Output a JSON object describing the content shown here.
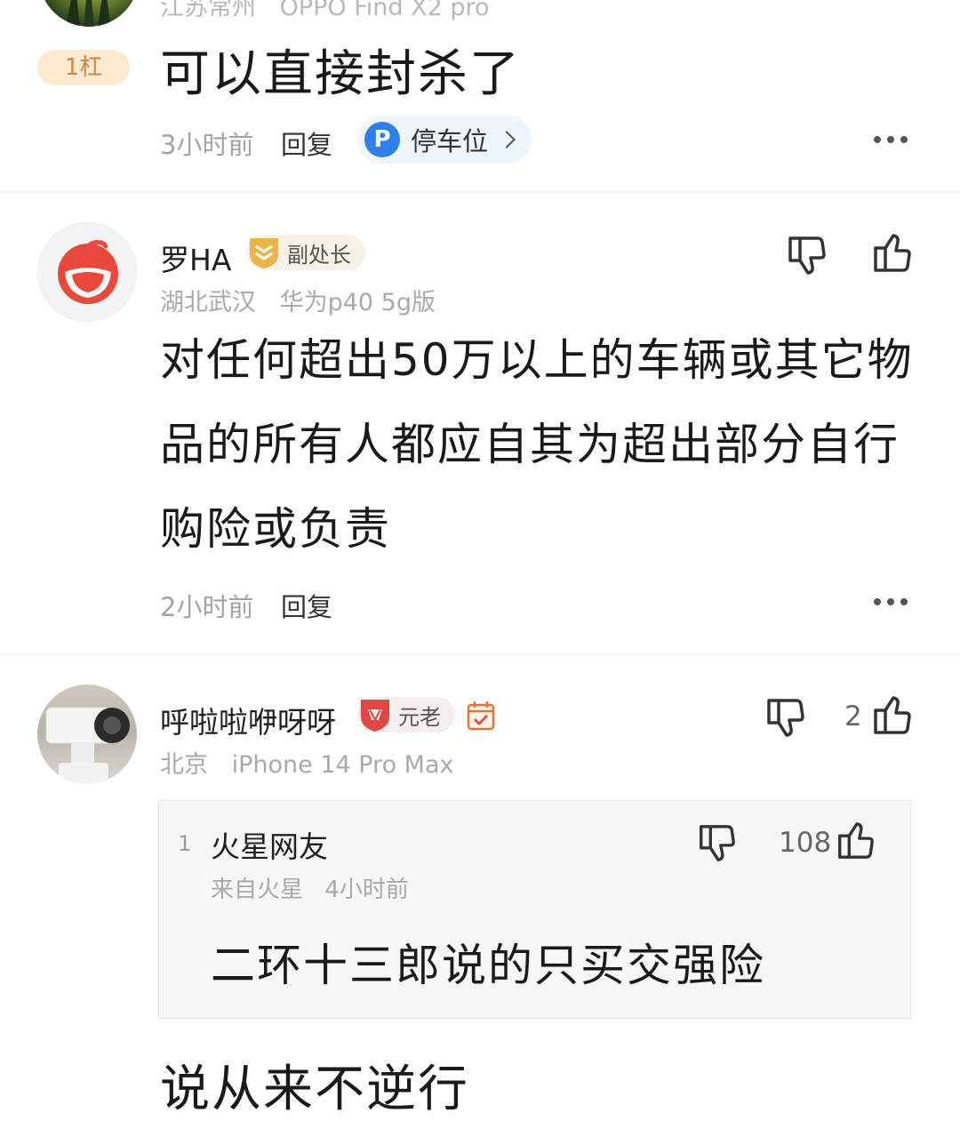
{
  "top_comment": {
    "location": "江苏常州",
    "device": "OPPO Find X2 pro",
    "rank_badge": "1杠",
    "text": "可以直接封杀了",
    "time": "3小时前",
    "reply_label": "回复",
    "parking_chip": {
      "icon": "P",
      "label": "停车位"
    }
  },
  "comment_2": {
    "username": "罗HA",
    "title_badge": "副处长",
    "location": "湖北武汉",
    "device": "华为p40 5g版",
    "text": "对任何超出50万以上的车辆或其它物品的所有人都应自其为超出部分自行购险或负责",
    "time": "2小时前",
    "reply_label": "回复"
  },
  "comment_3": {
    "username": "呼啦啦咿呀呀",
    "title_badge": "元老",
    "location": "北京",
    "device": "iPhone 14 Pro Max",
    "like_count": "2",
    "quote": {
      "index": "1",
      "username": "火星网友",
      "source": "来自火星",
      "time": "4小时前",
      "like_count": "108",
      "text": "二环十三郎说的只买交强险"
    },
    "text": "说从来不逆行"
  },
  "colors": {
    "rank_badge_bg": "#fde9cf",
    "parking_blue": "#2f7fe8",
    "badge_gold": "#e8b54a",
    "badge_red": "#e04848"
  }
}
